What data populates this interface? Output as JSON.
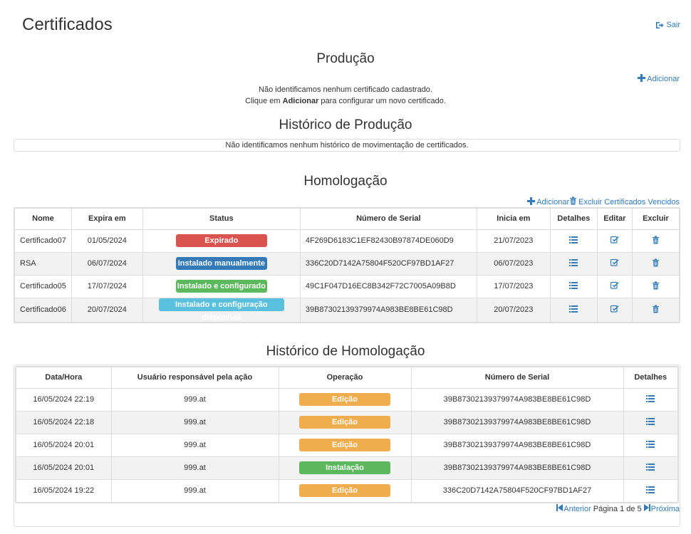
{
  "header": {
    "title": "Certificados",
    "logout_label": "Sair"
  },
  "producao": {
    "title": "Produção",
    "add_label": "Adicionar",
    "empty_line1": "Não identificamos nenhum certificado cadastrado.",
    "empty_line2_prefix": "Clique em ",
    "empty_line2_bold": "Adicionar",
    "empty_line2_suffix": " para configurar um novo certificado."
  },
  "historico_producao": {
    "title": "Histórico de Produção",
    "empty": "Não identificamos nenhum histórico de movimentação de certificados."
  },
  "homologacao": {
    "title": "Homologação",
    "add_label": "Adicionar",
    "delete_expired_label": "Excluir Certificados Vencidos",
    "columns": [
      "Nome",
      "Expira em",
      "Status",
      "Número de Serial",
      "Inicia em",
      "Detalhes",
      "Editar",
      "Excluir"
    ],
    "rows": [
      {
        "name": "Certificado07",
        "expires": "01/05/2024",
        "status": "Expirado",
        "status_color": "#d9534f",
        "serial": "4F269D6183C1EF82430B97874DE060D9",
        "starts": "21/07/2023"
      },
      {
        "name": "RSA",
        "expires": "06/07/2024",
        "status": "Instalado manualmente",
        "status_color": "#337ab7",
        "serial": "336C20D7142A75804F520CF97BD1AF27",
        "starts": "06/07/2023"
      },
      {
        "name": "Certificado05",
        "expires": "17/07/2024",
        "status": "Instalado e configurado",
        "status_color": "#5cb85c",
        "serial": "49C1F047D16EC8B342F72C7005A09B8D",
        "starts": "17/07/2023"
      },
      {
        "name": "Certificado06",
        "expires": "20/07/2024",
        "status": "Instalado e configuração disponível",
        "status_color": "#5bc0de",
        "serial": "39B87302139379974A983BE8BE61C98D",
        "starts": "20/07/2023"
      }
    ]
  },
  "historico_homologacao": {
    "title": "Histórico de Homologação",
    "columns": [
      "Data/Hora",
      "Usuário responsável pela ação",
      "Operação",
      "Número de Serial",
      "Detalhes"
    ],
    "rows": [
      {
        "datetime": "16/05/2024 22:19",
        "user": "999.at",
        "operation": "Edição",
        "op_color": "#f0ad4e",
        "serial": "39B87302139379974A983BE8BE61C98D"
      },
      {
        "datetime": "16/05/2024 22:18",
        "user": "999.at",
        "operation": "Edição",
        "op_color": "#f0ad4e",
        "serial": "39B87302139379974A983BE8BE61C98D"
      },
      {
        "datetime": "16/05/2024 20:01",
        "user": "999.at",
        "operation": "Edição",
        "op_color": "#f0ad4e",
        "serial": "39B87302139379974A983BE8BE61C98D"
      },
      {
        "datetime": "16/05/2024 20:01",
        "user": "999.at",
        "operation": "Instalação",
        "op_color": "#5cb85c",
        "serial": "39B87302139379974A983BE8BE61C98D"
      },
      {
        "datetime": "16/05/2024 19:22",
        "user": "999.at",
        "operation": "Edição",
        "op_color": "#f0ad4e",
        "serial": "336C20D7142A75804F520CF97BD1AF27"
      }
    ],
    "pager": {
      "prev_label": "Anterior",
      "page_text": "Página 1 de 5",
      "next_label": "Próxima"
    }
  },
  "icons": {
    "logout": "sign-out-icon",
    "add": "plus-icon",
    "trash": "trash-icon",
    "details": "list-icon",
    "edit": "edit-icon",
    "prev": "step-backward-icon",
    "next": "step-forward-icon"
  },
  "colors": {
    "link": "#337ab7",
    "border": "#dddddd",
    "stripe": "#f2f2f2"
  }
}
